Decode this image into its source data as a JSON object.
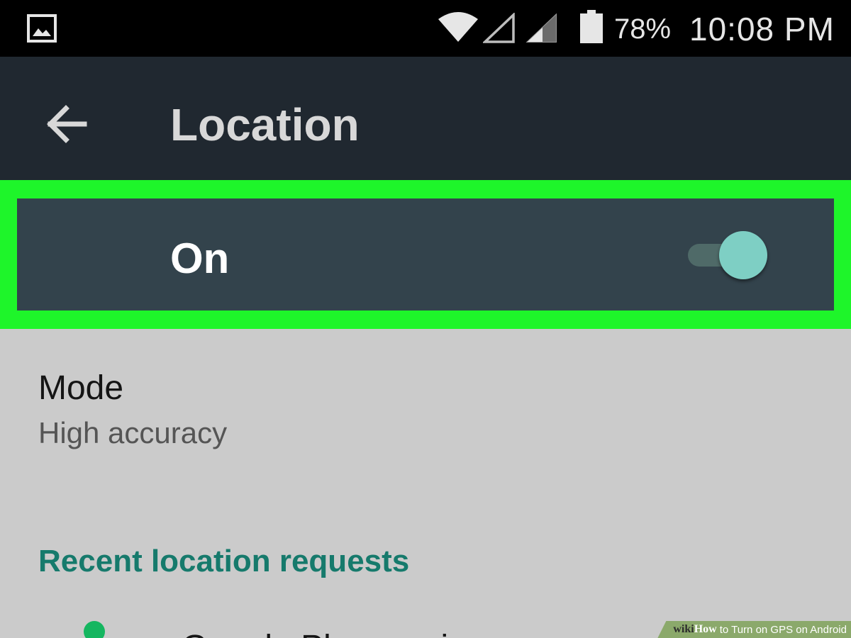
{
  "status_bar": {
    "battery": "78%",
    "time": "10:08 PM",
    "icons": [
      "gallery-icon",
      "wifi-icon",
      "signal-empty-icon",
      "signal-partial-icon",
      "battery-icon"
    ]
  },
  "app_bar": {
    "title": "Location",
    "back_icon": "arrow-back-icon"
  },
  "master_switch": {
    "label": "On",
    "checked": true
  },
  "mode": {
    "title": "Mode",
    "summary": "High accuracy"
  },
  "recent_requests": {
    "header": "Recent location requests",
    "items": [
      {
        "label": "Google Play services",
        "icon": "location-pin-icon"
      }
    ]
  },
  "caption": {
    "brand_part1": "wiki",
    "brand_part2": "How",
    "text": "to Turn on GPS on Android"
  },
  "colors": {
    "status_bar": "#000000",
    "app_bar": "#202830",
    "highlight": "#1ef52a",
    "switch_row": "#33434c",
    "toggle_thumb": "#7ecfc4",
    "toggle_track": "#4f6a68",
    "section_header": "#167a6c",
    "list_background": "#cbcbcb",
    "pin": "#15b660"
  }
}
